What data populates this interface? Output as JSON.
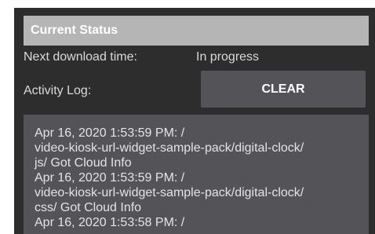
{
  "status": {
    "header": "Current Status",
    "next_download_label": "Next download time:",
    "next_download_value": "In progress",
    "activity_log_label": "Activity Log:",
    "clear_label": "CLEAR"
  },
  "activity_log": {
    "entries": [
      "Apr 16, 2020 1:53:59 PM: /\nvideo-kiosk-url-widget-sample-pack/digital-clock/\njs/ Got Cloud Info",
      "Apr 16, 2020 1:53:59 PM: /\nvideo-kiosk-url-widget-sample-pack/digital-clock/\ncss/ Got Cloud Info",
      "Apr 16, 2020 1:53:58 PM: /"
    ]
  },
  "colors": {
    "panel_bg": "#2d2d2d",
    "header_bg": "#b5b5b5",
    "button_bg": "#545358",
    "log_bg": "#545358"
  }
}
